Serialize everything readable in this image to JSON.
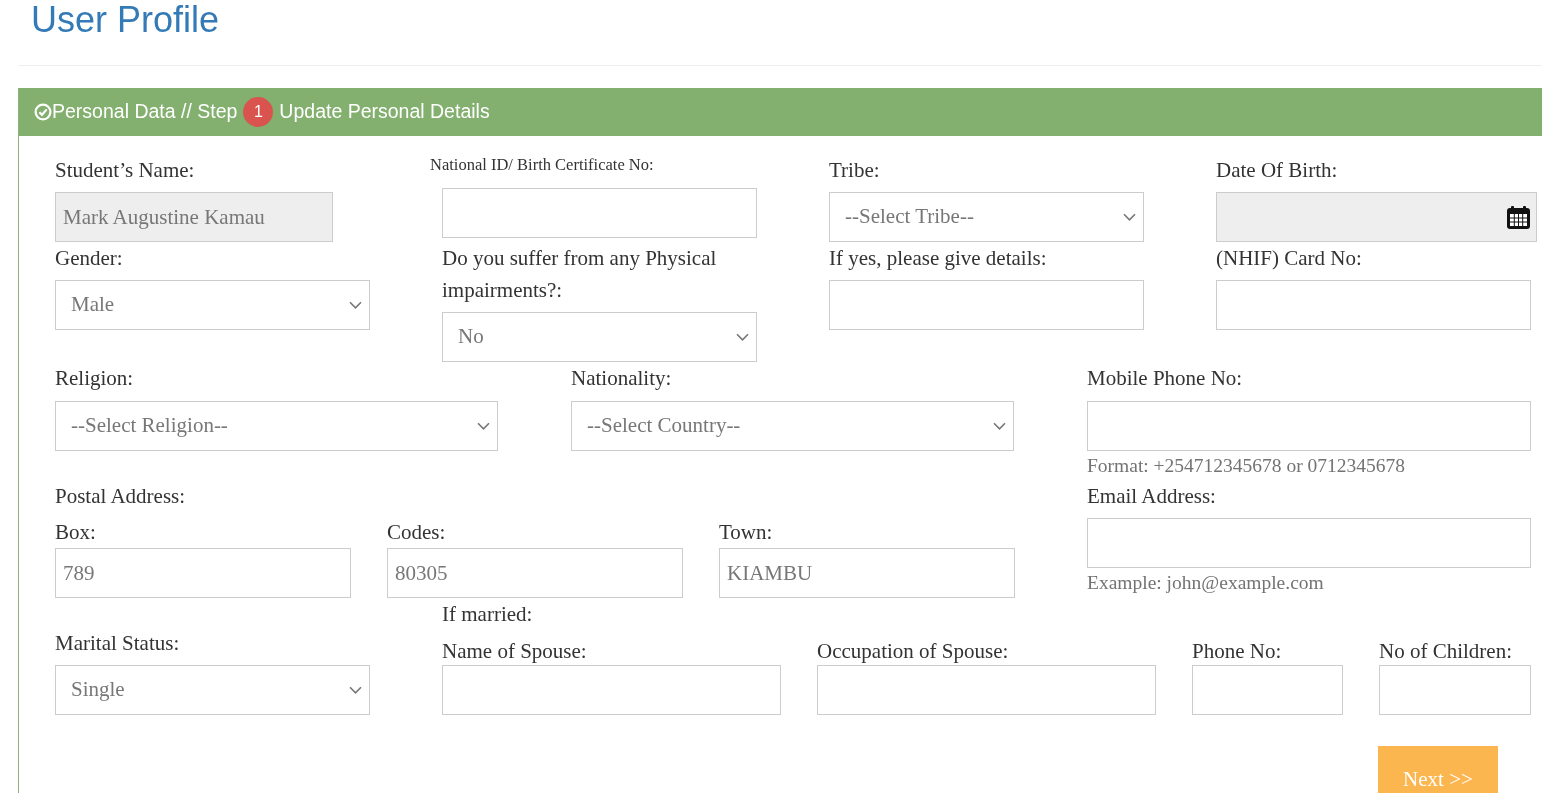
{
  "page_title": "User Profile",
  "panel": {
    "title": "Personal Data // Step",
    "step_badge": "1",
    "subtitle": "Update Personal Details",
    "personal_fields": [
      {
        "label": "Student’s Name:",
        "kind": "text",
        "value": "Mark Augustine Kamau",
        "readonly": true
      },
      {
        "label": "National ID/ Birth Certificate No:",
        "kind": "text",
        "readonly": false
      },
      {
        "label": "Tribe:",
        "kind": "select",
        "value": "--Select Tribe--",
        "readonly": false
      },
      {
        "label": "Date Of Birth:",
        "kind": "date",
        "readonly": true
      },
      {
        "label": "Gender:",
        "kind": "select",
        "value": "Male",
        "readonly": false
      },
      {
        "label": "Do you suffer from any Physical impairments?:",
        "kind": "select",
        "value": "No",
        "readonly": false
      },
      {
        "label": "If yes, please give details:",
        "kind": "text",
        "readonly": false
      },
      {
        "label": "(NHIF) Card No:",
        "kind": "text",
        "readonly": false
      }
    ],
    "origin_fields": [
      {
        "label": "Religion:",
        "kind": "select",
        "value": "--Select Religion--",
        "readonly": false
      },
      {
        "label": "Nationality:",
        "kind": "select",
        "value": "--Select Country--",
        "readonly": false
      }
    ],
    "contact_fields": [
      {
        "label": "Mobile Phone No:",
        "kind": "text",
        "readonly": false,
        "help": "Format: +254712345678 or 0712345678"
      },
      {
        "label": "Email Address:",
        "kind": "text",
        "readonly": false,
        "help": "Example: john@example.com"
      }
    ],
    "postal_address": {
      "label": "Postal Address:",
      "fields": [
        {
          "label": "Box:",
          "kind": "text",
          "value": "789",
          "readonly": false
        },
        {
          "label": "Codes:",
          "kind": "text",
          "value": "80305",
          "readonly": false
        },
        {
          "label": "Town:",
          "kind": "text",
          "value": "KIAMBU",
          "readonly": false
        }
      ]
    },
    "marital_status": {
      "label": "Marital Status:",
      "kind": "select",
      "value": "Single",
      "readonly": false
    },
    "spouse_details": {
      "label": "If married:",
      "fields": [
        {
          "label": "Name of Spouse:",
          "kind": "text",
          "readonly": false
        },
        {
          "label": "Occupation of Spouse:",
          "kind": "text",
          "readonly": false
        },
        {
          "label": "Phone No:",
          "kind": "text",
          "readonly": false
        },
        {
          "label": "No of Children:",
          "kind": "text",
          "readonly": false
        }
      ]
    },
    "next_button": "Next >>"
  }
}
